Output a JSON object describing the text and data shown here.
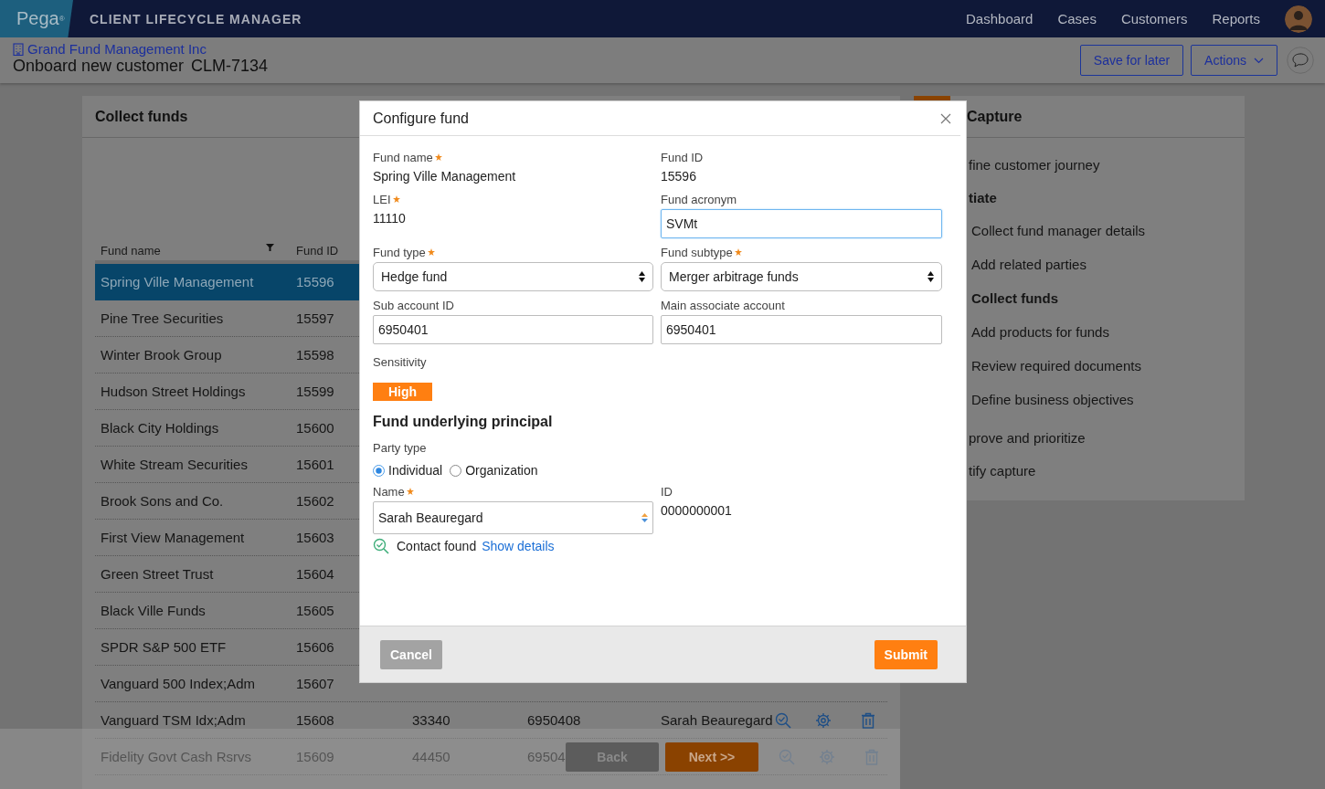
{
  "app_bar": {
    "logo": "Pega$^{®}$",
    "title": "CLIENT LIFECYCLE MANAGER",
    "nav": [
      "Dashboard",
      "Cases",
      "Customers",
      "Reports"
    ]
  },
  "case_header": {
    "customer": "Grand Fund Management Inc",
    "case_type": "Onboard new customer",
    "case_id": "CLM-7134",
    "buttons": [
      {
        "label": "Save for later",
        "kind": "plain"
      },
      {
        "label": "Actions",
        "kind": "menu"
      }
    ]
  },
  "funds_panel": {
    "title": "Collect funds",
    "columns": [
      "Fund name",
      "Fund ID"
    ],
    "rows": [
      {
        "cells": [
          "Spring Ville Management",
          "15596"
        ],
        "selected": true
      },
      {
        "cells": [
          "Pine Tree Securities",
          "15597"
        ],
        "selected": false
      },
      {
        "cells": [
          "Winter Brook Group",
          "15598"
        ],
        "selected": false
      },
      {
        "cells": [
          "Hudson Street Holdings",
          "15599"
        ],
        "selected": false
      },
      {
        "cells": [
          "Black City Holdings",
          "15600"
        ],
        "selected": false
      },
      {
        "cells": [
          "White Stream Securities",
          "15601"
        ],
        "selected": false
      },
      {
        "cells": [
          "Brook Sons and Co.",
          "15602"
        ],
        "selected": false
      },
      {
        "cells": [
          "First View Management",
          "15603"
        ],
        "selected": false
      },
      {
        "cells": [
          "Green Street Trust",
          "15604"
        ],
        "selected": false
      },
      {
        "cells": [
          "Black Ville Funds",
          "15605"
        ],
        "selected": false
      },
      {
        "cells": [
          "SPDR S&P 500 ETF",
          "15606"
        ],
        "selected": false
      },
      {
        "cells": [
          "Vanguard 500 Index;Adm",
          "15607"
        ],
        "selected": false
      },
      {
        "cells": [
          "Vanguard TSM Idx;Adm",
          "15608",
          "33340",
          "6950408",
          "Sarah Beauregard"
        ],
        "selected": false,
        "actions": true
      },
      {
        "cells": [
          "Fidelity Govt Cash Rsrvs",
          "15609",
          "44450",
          "69504"
        ],
        "selected": false,
        "actions": true
      }
    ]
  },
  "capture_panel": {
    "title": "Capture",
    "stages": [
      {
        "label": "fine customer journey",
        "current": false
      },
      {
        "label": "tiate",
        "current": true,
        "children": [
          {
            "label": "Collect fund manager details",
            "current": false
          },
          {
            "label": "Add related parties",
            "current": false
          },
          {
            "label": "Collect funds",
            "current": true
          },
          {
            "label": "Add products for funds",
            "current": false
          },
          {
            "label": "Review required documents",
            "current": false
          },
          {
            "label": "Define business objectives",
            "current": false
          }
        ]
      },
      {
        "label": "prove and prioritize",
        "current": false
      },
      {
        "label": "tify capture",
        "current": false
      }
    ]
  },
  "wizard_footer": {
    "buttons": [
      {
        "label": "Back",
        "kind": "secondary"
      },
      {
        "label": "Next >>",
        "kind": "primary"
      }
    ]
  },
  "dialog": {
    "title": "Configure fund",
    "fields": [
      {
        "kind": "display",
        "label": "Fund name",
        "required": true,
        "value": "Spring Ville Management"
      },
      {
        "kind": "display",
        "label": "Fund ID",
        "required": false,
        "value": "15596"
      },
      {
        "kind": "display",
        "label": "LEI",
        "required": true,
        "value": "11110"
      },
      {
        "kind": "input",
        "label": "Fund acronym",
        "required": false,
        "value": "SVMt",
        "focused": true
      },
      {
        "kind": "select",
        "label": "Fund type",
        "required": true,
        "value": "Hedge fund"
      },
      {
        "kind": "select",
        "label": "Fund subtype",
        "required": true,
        "value": "Merger arbitrage funds"
      },
      {
        "kind": "input",
        "label": "Sub account ID",
        "required": false,
        "value": "6950401",
        "focused": false
      },
      {
        "kind": "input",
        "label": "Main associate account",
        "required": false,
        "value": "6950401",
        "focused": false
      }
    ],
    "sensitivity": {
      "label": "Sensitivity",
      "value": "High"
    },
    "section_title": "Fund underlying principal",
    "party_type": {
      "label": "Party type",
      "options": [
        {
          "label": "Individual",
          "selected": true
        },
        {
          "label": "Organization",
          "selected": false
        }
      ]
    },
    "principal_fields": [
      {
        "kind": "autocomplete",
        "label": "Name",
        "required": true,
        "value": "Sarah Beauregard"
      },
      {
        "kind": "display",
        "label": "ID",
        "required": false,
        "value": "0000000001"
      }
    ],
    "lookup": {
      "status": "Contact found",
      "link": "Show details"
    },
    "buttons": [
      {
        "label": "Cancel",
        "kind": "secondary"
      },
      {
        "label": "Submit",
        "kind": "primary"
      }
    ]
  }
}
